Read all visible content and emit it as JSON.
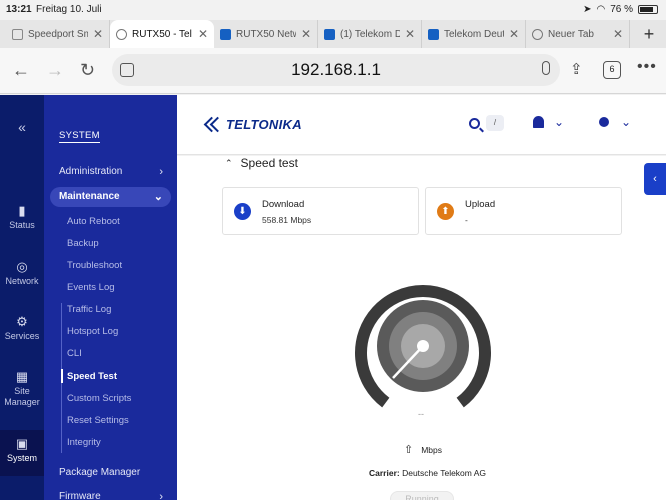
{
  "status_bar": {
    "time": "13:21",
    "date": "Freitag 10. Juli",
    "battery": "76 %"
  },
  "tabs": [
    {
      "title": "Speedport Sm",
      "icon": "speedport-icon"
    },
    {
      "title": "RUTX50 - Tel",
      "icon": "globe-icon"
    },
    {
      "title": "RUTX50 Netw",
      "icon": "telekom-icon"
    },
    {
      "title": "(1) Telekom D",
      "icon": "telekom-icon"
    },
    {
      "title": "Telekom Deut",
      "icon": "telekom-icon"
    },
    {
      "title": "Neuer Tab",
      "icon": "globe-icon"
    }
  ],
  "address": {
    "url": "192.168.1.1",
    "tab_count": "6"
  },
  "rail": {
    "items": [
      {
        "label": "Status",
        "icon": "signal-bars-icon"
      },
      {
        "label": "Network",
        "icon": "globe-icon"
      },
      {
        "label": "Services",
        "icon": "gear-icon"
      },
      {
        "label": "Site Manager",
        "icon": "site-manager-icon"
      },
      {
        "label": "System",
        "icon": "system-icon"
      }
    ]
  },
  "sidebar": {
    "title": "SYSTEM",
    "administration": "Administration",
    "maintenance": "Maintenance",
    "sub_items": [
      "Auto Reboot",
      "Backup",
      "Troubleshoot",
      "Events Log",
      "Traffic Log",
      "Hotspot Log",
      "CLI",
      "Speed Test",
      "Custom Scripts",
      "Reset Settings",
      "Integrity"
    ],
    "package_manager": "Package Manager",
    "firmware": "Firmware"
  },
  "header": {
    "logo": "TELTONIKA",
    "search_shortcut": "/"
  },
  "speedtest": {
    "title": "Speed test",
    "download_label": "Download",
    "download_value": "558.81 Mbps",
    "upload_label": "Upload",
    "upload_value": "-",
    "gauge_value": "--",
    "unit": "Mbps",
    "carrier_label": "Carrier:",
    "carrier_value": "Deutsche Telekom AG",
    "button": "Running"
  },
  "colors": {
    "sidebar": "#1a2a9c",
    "rail": "#0b1c6a",
    "download": "#1a3fc8",
    "upload": "#e07b16"
  }
}
